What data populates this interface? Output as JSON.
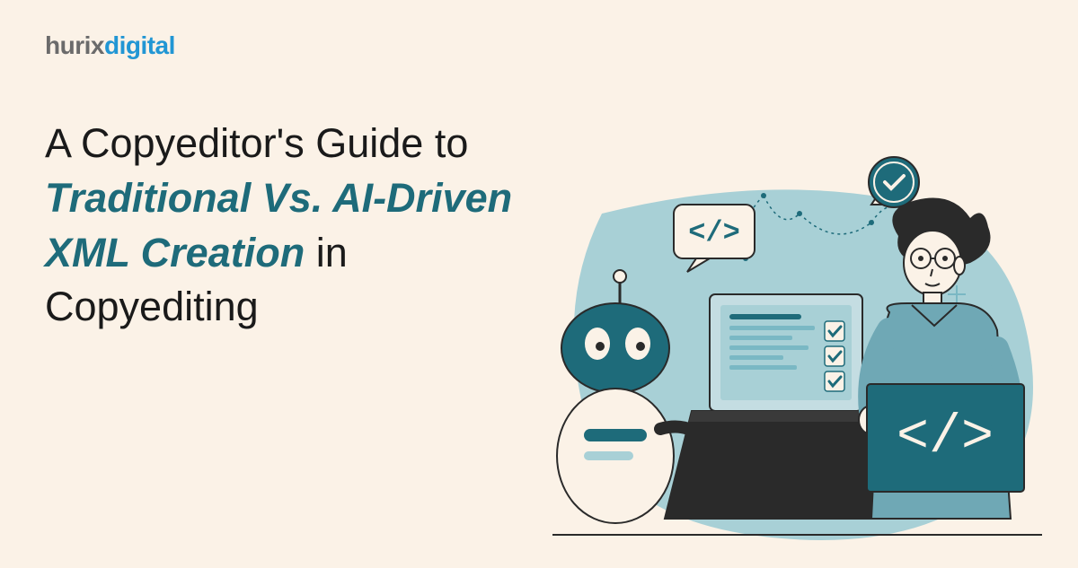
{
  "logo": {
    "part1": "hurix",
    "part2": "digital"
  },
  "headline": {
    "line1": "A Copyeditor's Guide to",
    "highlight1": "Traditional Vs. AI-Driven",
    "highlight2": "XML Creation",
    "line3_suffix": " in",
    "line4": "Copyediting"
  },
  "colors": {
    "background": "#fbf2e7",
    "text_primary": "#1a1a1a",
    "text_highlight": "#1e6b7a",
    "logo_gray": "#6b6b6b",
    "logo_blue": "#2196d4",
    "illustration_teal": "#1e6b7a",
    "illustration_light": "#a8d0d6",
    "illustration_dark": "#2a2a2a"
  }
}
